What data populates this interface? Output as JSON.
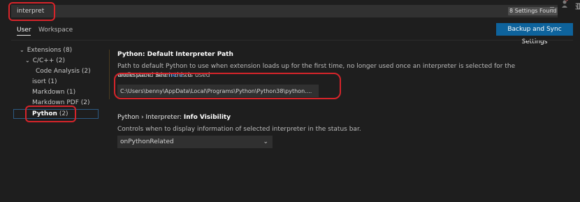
{
  "search": {
    "value": "interpret",
    "results_badge": "8 Settings Found"
  },
  "toolbar": {
    "filter_icon": "filter-lines-icon",
    "right_glyph": "亚"
  },
  "tabs": [
    {
      "label": "User",
      "selected": true
    },
    {
      "label": "Workspace",
      "selected": false
    }
  ],
  "backup_button": {
    "label": "Backup and Sync Settings",
    "color": "#0e639c"
  },
  "tree": [
    {
      "label": "Extensions (8)",
      "expanded": true
    },
    {
      "label": "C/C++ (2)",
      "expanded": true
    },
    {
      "label": "Code Analysis (2)"
    },
    {
      "label": "isort (1)"
    },
    {
      "label": "Markdown (1)"
    },
    {
      "label": "Markdown PDF (2)"
    },
    {
      "label": "Python",
      "count": "(2)",
      "selected": true
    }
  ],
  "settings": [
    {
      "category": "Python: ",
      "name": "Default Interpreter Path",
      "description_line1": "Path to default Python to use when extension loads up for the first time, no longer used once an interpreter is selected for the workspace. See",
      "link_text": "here",
      "description_after_link": "to",
      "description_line2": "understand when this is used",
      "value": "C:\\Users\\benny\\AppData\\Local\\Programs\\Python\\Python38\\python...."
    },
    {
      "category": "Python › Interpreter: ",
      "name": "Info Visibility",
      "description": "Controls when to display information of selected interpreter in the status bar.",
      "value": "onPythonRelated"
    }
  ],
  "colors": {
    "background": "#1e1e1e",
    "annotation": "#d6242a",
    "link": "#3794ff",
    "accent_button": "#0e639c"
  }
}
